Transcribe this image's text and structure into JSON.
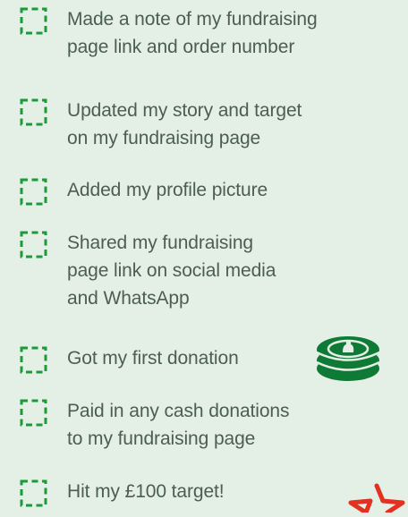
{
  "checklist": {
    "items": [
      {
        "label": "Made a note of my fundraising\npage link and order number",
        "checked": false
      },
      {
        "label": "Updated my story and target\non my fundraising page",
        "checked": false
      },
      {
        "label": "Added my profile picture",
        "checked": false
      },
      {
        "label": "Shared my fundraising\npage link on social media\nand WhatsApp",
        "checked": false
      },
      {
        "label": "Got my first donation",
        "checked": false
      },
      {
        "label": "Paid in any cash donations\nto my fundraising page",
        "checked": false
      },
      {
        "label": "Hit my £100 target!",
        "checked": false
      }
    ]
  },
  "decorations": {
    "coin": "coin-stack-icon",
    "star": "star-icon"
  },
  "colors": {
    "background": "#e4f0e6",
    "checkbox": "#1a9a3a",
    "text": "#4b5d55",
    "coin": "#0f7a36",
    "star": "#e3301f"
  }
}
